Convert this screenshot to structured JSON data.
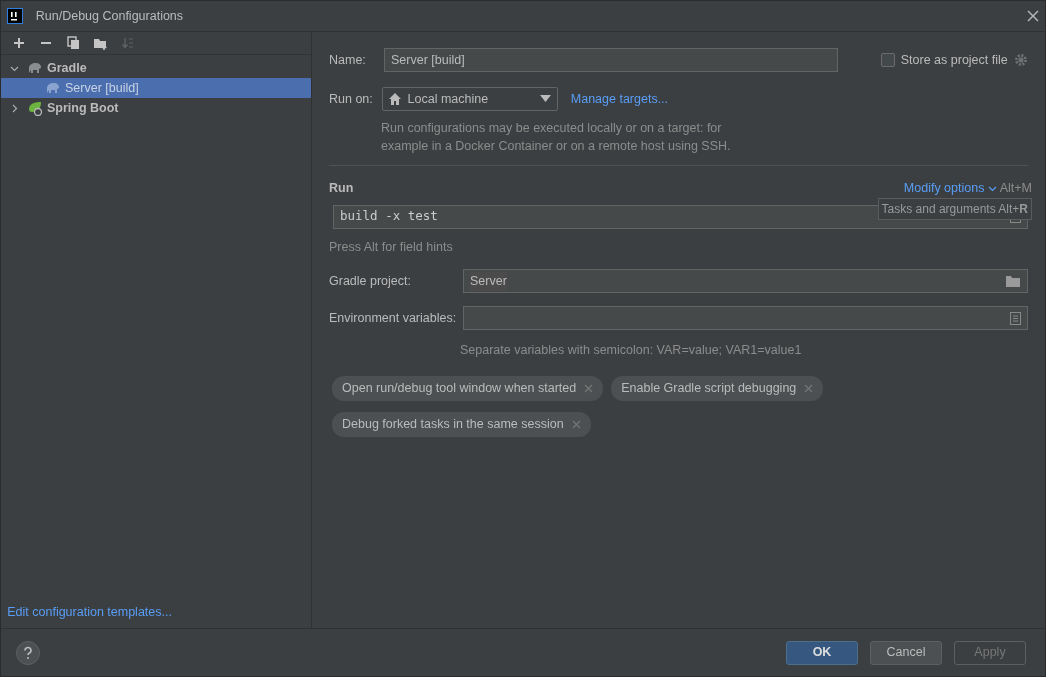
{
  "window": {
    "title": "Run/Debug Configurations"
  },
  "toolbar": [
    {
      "kind": "add",
      "disabled": false
    },
    {
      "kind": "remove",
      "disabled": false
    },
    {
      "kind": "copy",
      "disabled": false
    },
    {
      "kind": "folder",
      "disabled": false
    },
    {
      "kind": "sort",
      "disabled": true
    }
  ],
  "tree": [
    {
      "label": "Gradle",
      "kind": "gradle",
      "expanded": true,
      "selected": false,
      "children": [
        {
          "label": "Server [build]",
          "kind": "gradle",
          "selected": true
        }
      ]
    },
    {
      "label": "Spring Boot",
      "kind": "spring",
      "expanded": false,
      "selected": false
    }
  ],
  "templates_link": "Edit configuration templates...",
  "form": {
    "name_label": "Name:",
    "name_value": "Server [build]",
    "store_label": "Store as project file",
    "store_checked": false,
    "run_on_label": "Run on:",
    "run_on_value": "Local machine",
    "manage_link": "Manage targets...",
    "run_on_hint": "Run configurations may be executed locally or on a target: for example in a Docker Container or on a remote host using SSH.",
    "section_title": "Run",
    "modify_options": "Modify options",
    "modify_shortcut": "Alt+M",
    "tasks_value": "build -x test",
    "tooltip": "Tasks and arguments Alt+**R**",
    "field_hint": "Press Alt for field hints",
    "project_label": "Gradle project:",
    "project_value": "Server",
    "env_label": "Environment variables:",
    "env_hint": "Separate variables with semicolon: VAR=value; VAR1=value1",
    "options": [
      "Open run/debug tool window when started",
      "Enable Gradle script debugging",
      "Debug forked tasks in the same session"
    ]
  },
  "buttons": [
    {
      "label": "OK",
      "kind": "default",
      "disabled": false
    },
    {
      "label": "Cancel",
      "kind": "normal",
      "disabled": false
    },
    {
      "label": "Apply",
      "kind": "normal",
      "disabled": true
    }
  ]
}
